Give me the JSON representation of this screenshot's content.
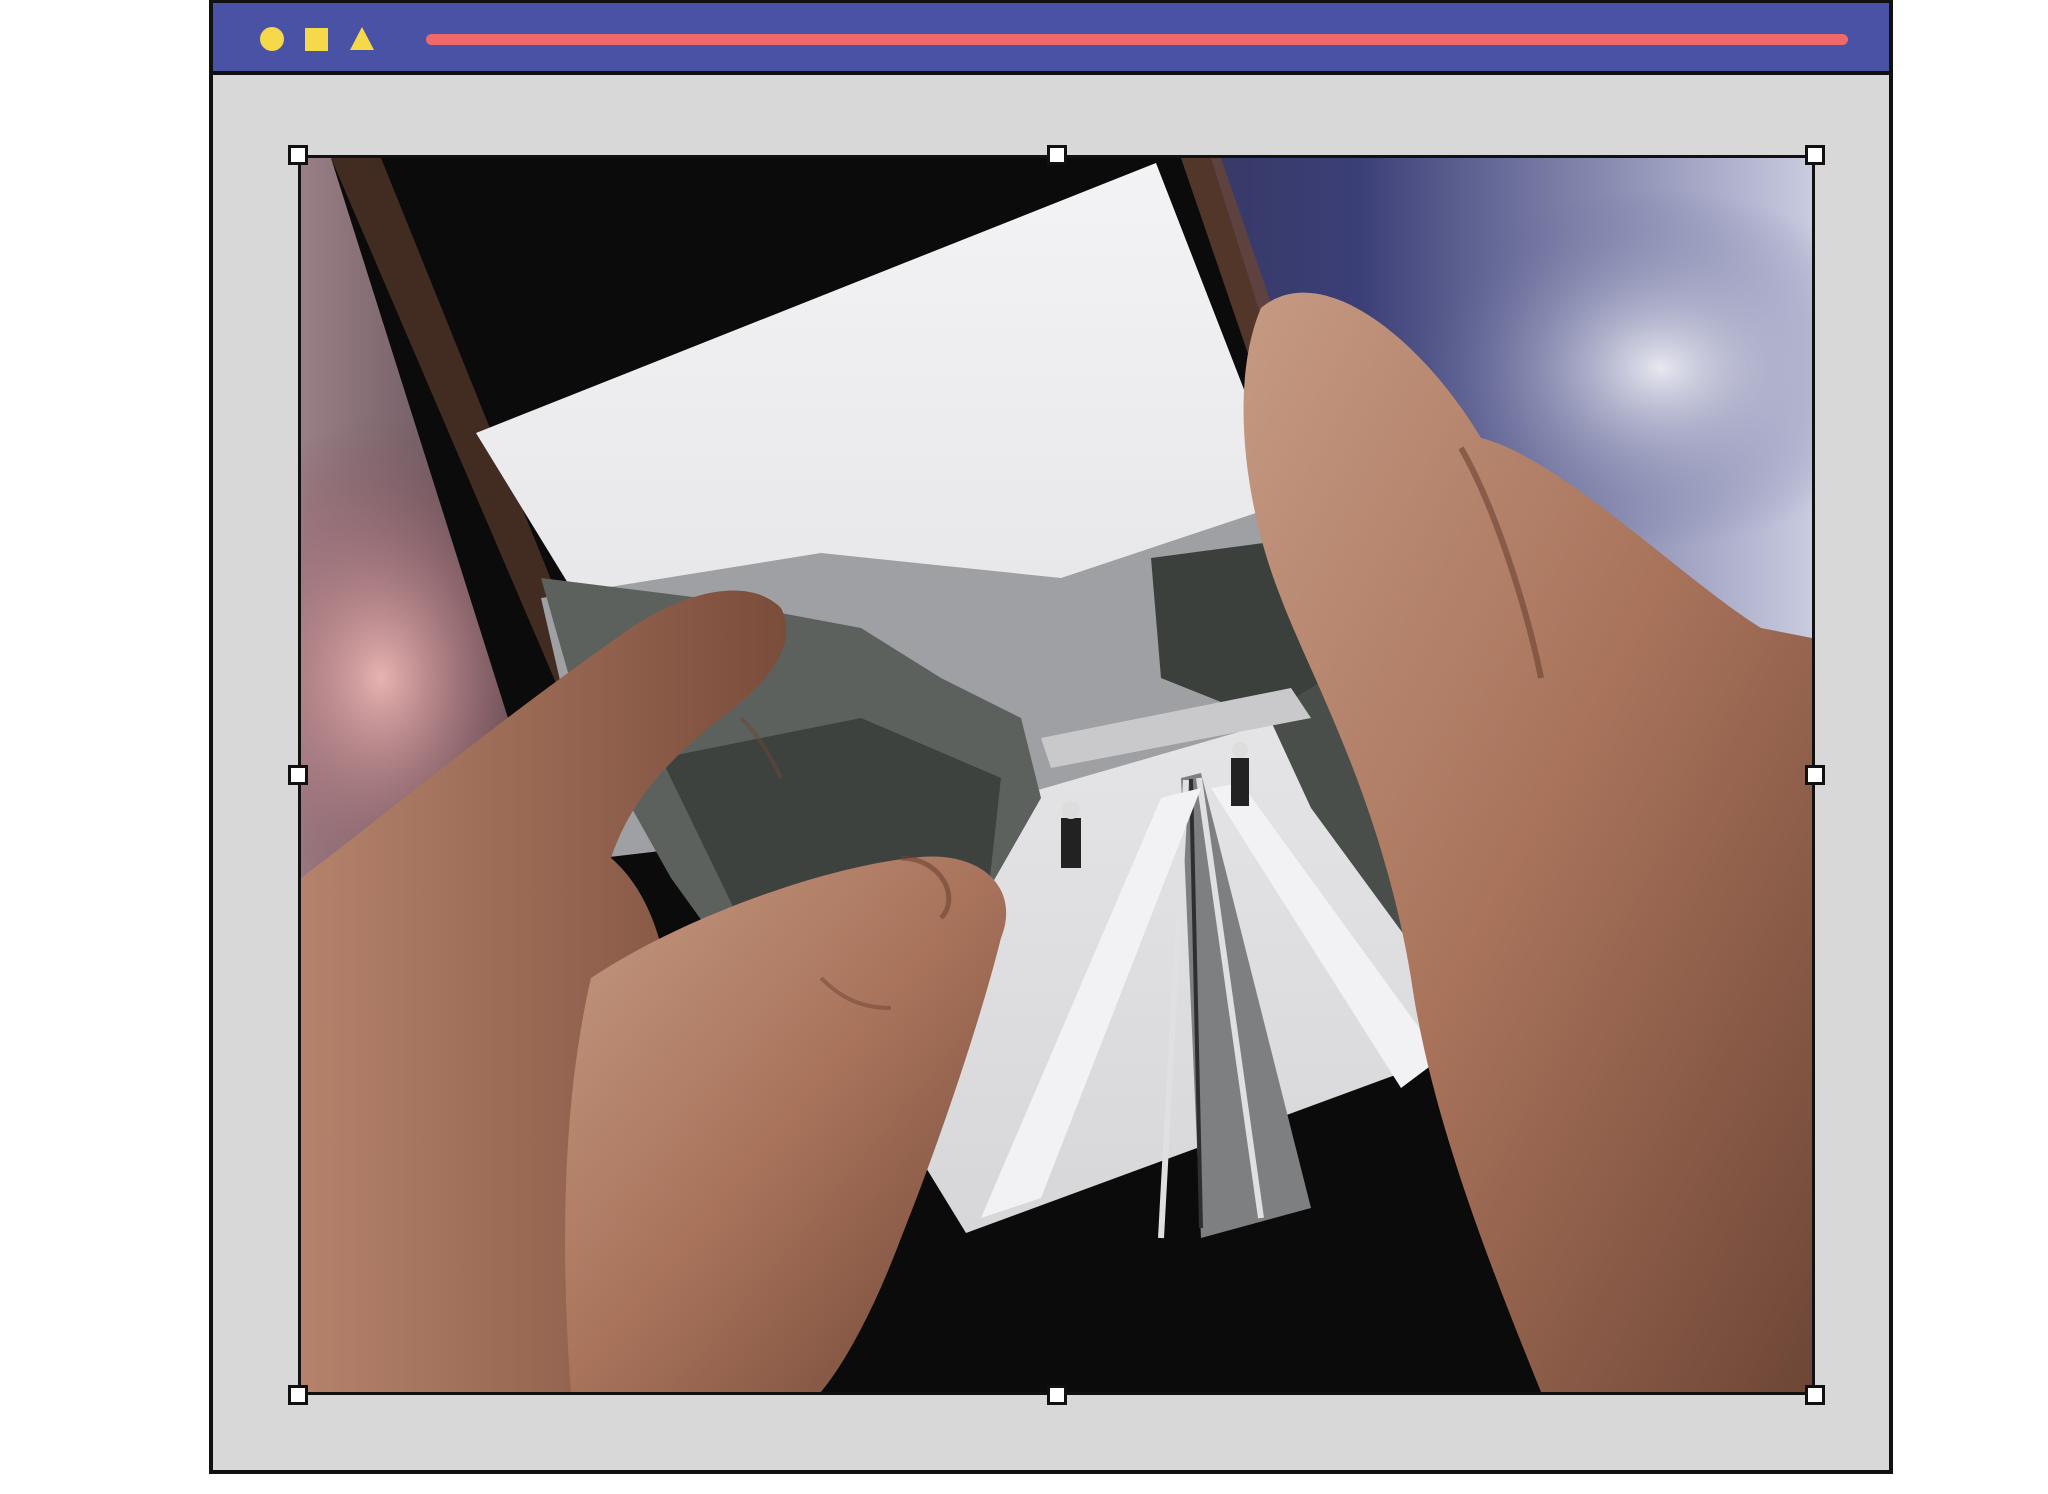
{
  "window": {
    "controls": [
      "circle-icon",
      "square-icon",
      "triangle-icon"
    ],
    "colors": {
      "titlebar": "#4a52a5",
      "controls": "#f6d94a",
      "addressbar": "#ee6a6a",
      "canvas": "#d8d8d8"
    }
  },
  "image": {
    "selected": true,
    "handles": [
      "top-left",
      "top-center",
      "top-right",
      "middle-left",
      "middle-right",
      "bottom-left",
      "bottom-center",
      "bottom-right"
    ]
  }
}
